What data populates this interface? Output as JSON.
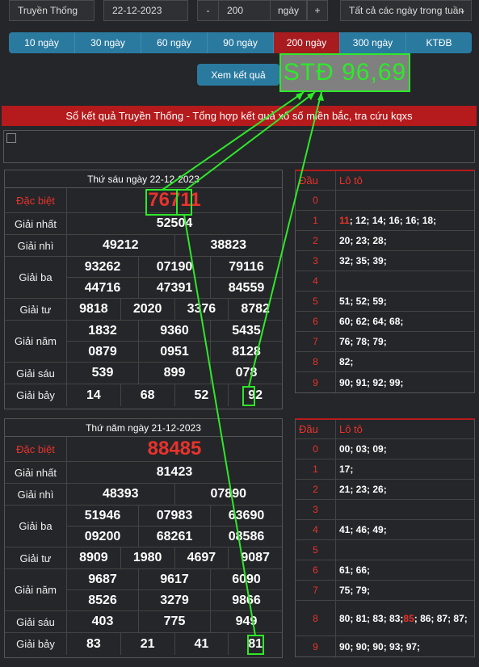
{
  "controls": {
    "region": "Truyền Thống",
    "date": "22-12-2023",
    "minus": "-",
    "days": "200",
    "days_unit": "ngày",
    "plus": "+",
    "filter": "Tất cả các ngày trong tuần"
  },
  "range_buttons": [
    "10 ngày",
    "30 ngày",
    "60 ngày",
    "90 ngày",
    "200 ngày",
    "300 ngày",
    "KTĐB"
  ],
  "active_range": "200 ngày",
  "view_button": "Xem kết quả",
  "std_label": "STĐ 96,69",
  "banner": "Sổ kết quả Truyền Thống - Tổng hợp kết quả xổ số miền bắc, tra cứu kqxs",
  "accent": "#b51a1c",
  "highlight_green": "#2ee82a",
  "results": [
    {
      "title": "Thứ sáu ngày 22-12-2023",
      "prizes": [
        {
          "label": "Đặc biệt",
          "lines": [
            [
              "76711"
            ]
          ]
        },
        {
          "label": "Giải nhất",
          "lines": [
            [
              "52504"
            ]
          ]
        },
        {
          "label": "Giải nhì",
          "lines": [
            [
              "49212",
              "38823"
            ]
          ]
        },
        {
          "label": "Giải ba",
          "lines": [
            [
              "93262",
              "07190",
              "79116"
            ],
            [
              "44716",
              "47391",
              "84559"
            ]
          ]
        },
        {
          "label": "Giải tư",
          "lines": [
            [
              "9818",
              "2020",
              "3376",
              "8782"
            ]
          ]
        },
        {
          "label": "Giải năm",
          "lines": [
            [
              "1832",
              "9360",
              "5435"
            ],
            [
              "0879",
              "0951",
              "8128"
            ]
          ]
        },
        {
          "label": "Giải sáu",
          "lines": [
            [
              "539",
              "899",
              "078"
            ]
          ]
        },
        {
          "label": "Giải bảy",
          "lines": [
            [
              "14",
              "68",
              "52",
              "92"
            ]
          ]
        }
      ],
      "loto_header": [
        "Đầu",
        "Lô tô"
      ],
      "loto": [
        [
          "0",
          ""
        ],
        [
          "1",
          "11; 12; 14; 16; 16; 18;"
        ],
        [
          "2",
          "20; 23; 28;"
        ],
        [
          "3",
          "32; 35; 39;"
        ],
        [
          "4",
          ""
        ],
        [
          "5",
          "51; 52; 59;"
        ],
        [
          "6",
          "60; 62; 64; 68;"
        ],
        [
          "7",
          "76; 78; 79;"
        ],
        [
          "8",
          "82;"
        ],
        [
          "9",
          "90; 91; 92; 99;"
        ]
      ],
      "loto_highlight": "11"
    },
    {
      "title": "Thứ năm ngày 21-12-2023",
      "prizes": [
        {
          "label": "Đặc biệt",
          "lines": [
            [
              "88485"
            ]
          ]
        },
        {
          "label": "Giải nhất",
          "lines": [
            [
              "81423"
            ]
          ]
        },
        {
          "label": "Giải nhì",
          "lines": [
            [
              "48393",
              "07890"
            ]
          ]
        },
        {
          "label": "Giải ba",
          "lines": [
            [
              "51946",
              "07983",
              "63690"
            ],
            [
              "09200",
              "68261",
              "08586"
            ]
          ]
        },
        {
          "label": "Giải tư",
          "lines": [
            [
              "8909",
              "1980",
              "4697",
              "9087"
            ]
          ]
        },
        {
          "label": "Giải năm",
          "lines": [
            [
              "9687",
              "9617",
              "6090"
            ],
            [
              "8526",
              "3279",
              "9866"
            ]
          ]
        },
        {
          "label": "Giải sáu",
          "lines": [
            [
              "403",
              "775",
              "949"
            ]
          ]
        },
        {
          "label": "Giải bảy",
          "lines": [
            [
              "83",
              "21",
              "41",
              "81"
            ]
          ]
        }
      ],
      "loto_header": [
        "Đầu",
        "Lô tô"
      ],
      "loto": [
        [
          "0",
          "00; 03; 09;"
        ],
        [
          "1",
          "17;"
        ],
        [
          "2",
          "21; 23; 26;"
        ],
        [
          "3",
          ""
        ],
        [
          "4",
          "41; 46; 49;"
        ],
        [
          "5",
          ""
        ],
        [
          "6",
          "61; 66;"
        ],
        [
          "7",
          "75; 79;"
        ],
        [
          "8",
          "80; 81; 83; 83; 85; 86; 87; 87;"
        ],
        [
          "9",
          "90; 90; 90; 93; 97;"
        ]
      ],
      "loto_highlight": "85"
    }
  ]
}
